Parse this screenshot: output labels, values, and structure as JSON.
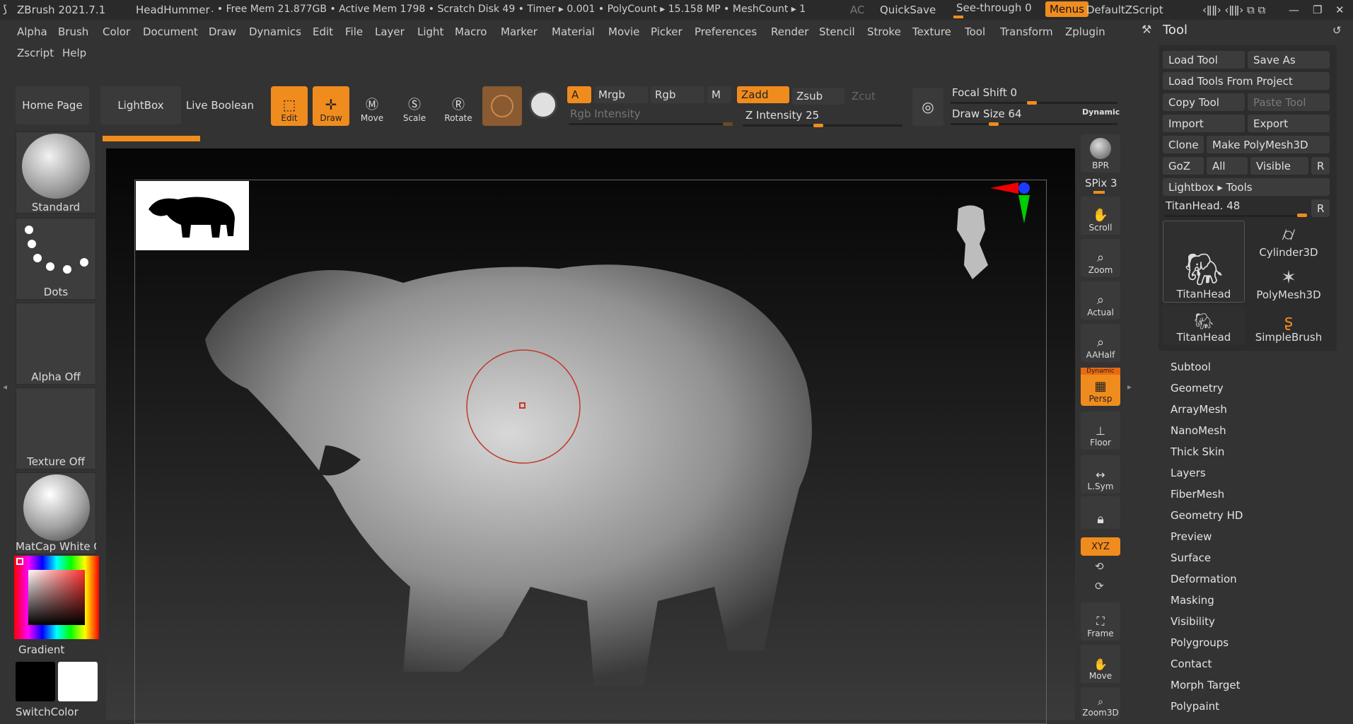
{
  "titlebar": {
    "app": "ZBrush 2021.7.1",
    "document": "HeadHummer",
    "stats": ". • Free Mem 21.877GB • Active Mem 1798 • Scratch Disk 49 • Timer ▸ 0.001 • PolyCount ▸ 15.158 MP • MeshCount ▸ 1",
    "ac": "AC",
    "quicksave": "QuickSave",
    "seethrough": "See-through 0",
    "menus": "Menus",
    "zscript": "DefaultZScript"
  },
  "menubar": {
    "row1": [
      "Alpha",
      "Brush",
      "Color",
      "Document",
      "Draw",
      "Dynamics",
      "Edit",
      "File",
      "Layer",
      "Light",
      "Macro",
      "Marker",
      "Material",
      "Movie",
      "Picker",
      "Preferences",
      "Render",
      "Stencil",
      "Stroke",
      "Texture",
      "Tool",
      "Transform",
      "Zplugin"
    ],
    "row2": [
      "Zscript",
      "Help"
    ]
  },
  "toolbar": {
    "home": "Home Page",
    "lightbox": "LightBox",
    "liveboolean": "Live Boolean",
    "edit": "Edit",
    "draw": "Draw",
    "move": "Move",
    "scale": "Scale",
    "rotate": "Rotate",
    "a": "A",
    "mrgb": "Mrgb",
    "rgb": "Rgb",
    "m": "M",
    "zadd": "Zadd",
    "zsub": "Zsub",
    "zcut": "Zcut",
    "rgb_intensity": "Rgb Intensity",
    "z_intensity": "Z Intensity 25",
    "focal_shift": "Focal Shift 0",
    "draw_size": "Draw Size 64",
    "dynamic": "Dynamic"
  },
  "shelf": {
    "standard": "Standard",
    "dots": "Dots",
    "alpha_off": "Alpha Off",
    "texture_off": "Texture Off",
    "matcap": "MatCap White C",
    "gradient": "Gradient",
    "switchcolor": "SwitchColor"
  },
  "rightstrip": {
    "bpr": "BPR",
    "spix": "SPix 3",
    "scroll": "Scroll",
    "zoom": "Zoom",
    "actual": "Actual",
    "aahalf": "AAHalf",
    "dynamic": "Dynamic",
    "persp": "Persp",
    "floor": "Floor",
    "lsym": "L.Sym",
    "xyz": "XYZ",
    "frame": "Frame",
    "move": "Move",
    "zoom3d": "Zoom3D"
  },
  "toolpanel": {
    "title": "Tool",
    "load_tool": "Load Tool",
    "save_as": "Save As",
    "load_from_project": "Load Tools From Project",
    "copy_tool": "Copy Tool",
    "paste_tool": "Paste Tool",
    "import": "Import",
    "export": "Export",
    "clone": "Clone",
    "make_polymesh": "Make PolyMesh3D",
    "goz": "GoZ",
    "all": "All",
    "visible": "Visible",
    "r": "R",
    "lightbox_tools": "Lightbox ▸ Tools",
    "titanhead_slider": "TitanHead. 48",
    "thumbs": [
      "TitanHead",
      "Cylinder3D",
      "PolyMesh3D",
      "TitanHead",
      "SimpleBrush"
    ],
    "sections": [
      "Subtool",
      "Geometry",
      "ArrayMesh",
      "NanoMesh",
      "Thick Skin",
      "Layers",
      "FiberMesh",
      "Geometry HD",
      "Preview",
      "Surface",
      "Deformation",
      "Masking",
      "Visibility",
      "Polygroups",
      "Contact",
      "Morph Target",
      "Polypaint"
    ]
  },
  "colors": {
    "accent": "#f08c1e",
    "bg": "#333333",
    "panel": "#3a3a3a"
  }
}
